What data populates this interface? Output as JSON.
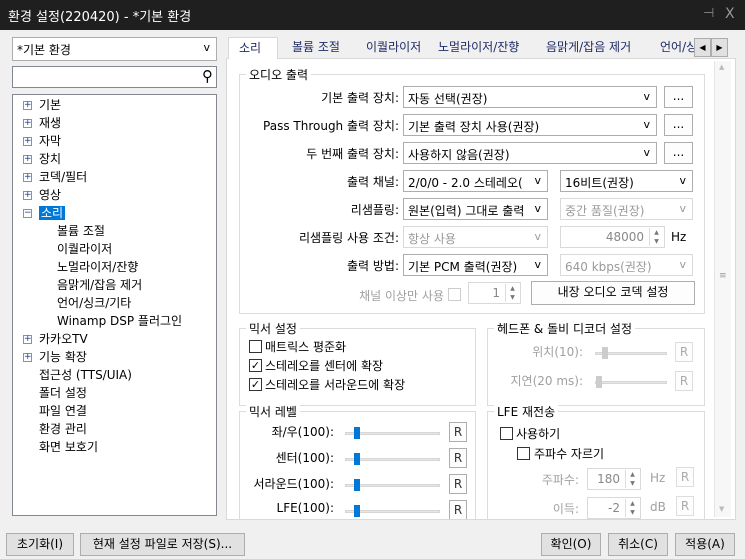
{
  "window": {
    "title": "환경 설정(220420) - *기본 환경",
    "pin_icon": "pin-icon",
    "close_icon": "close-icon",
    "close_glyph": "X"
  },
  "profile_combo": {
    "value": "*기본 환경"
  },
  "search": {
    "value": "",
    "placeholder": ""
  },
  "tree": {
    "items": [
      {
        "label": "기본",
        "level": 0,
        "expander": "+"
      },
      {
        "label": "재생",
        "level": 0,
        "expander": "+"
      },
      {
        "label": "자막",
        "level": 0,
        "expander": "+"
      },
      {
        "label": "장치",
        "level": 0,
        "expander": "+"
      },
      {
        "label": "코덱/필터",
        "level": 0,
        "expander": "+"
      },
      {
        "label": "영상",
        "level": 0,
        "expander": "+"
      },
      {
        "label": "소리",
        "level": 0,
        "expander": "−",
        "selected": true
      },
      {
        "label": "볼륨 조절",
        "level": 1
      },
      {
        "label": "이퀄라이저",
        "level": 1
      },
      {
        "label": "노멀라이저/잔향",
        "level": 1
      },
      {
        "label": "음맑게/잡음 제거",
        "level": 1
      },
      {
        "label": "언어/싱크/기타",
        "level": 1
      },
      {
        "label": "Winamp DSP 플러그인",
        "level": 1
      },
      {
        "label": "카카오TV",
        "level": 0,
        "expander": "+"
      },
      {
        "label": "기능 확장",
        "level": 0,
        "expander": "+"
      },
      {
        "label": "접근성 (TTS/UIA)",
        "level": 0
      },
      {
        "label": "폴더 설정",
        "level": 0
      },
      {
        "label": "파일 연결",
        "level": 0
      },
      {
        "label": "환경 관리",
        "level": 0
      },
      {
        "label": "화면 보호기",
        "level": 0
      }
    ]
  },
  "tabs": [
    {
      "label": "소리",
      "active": true
    },
    {
      "label": "볼륨 조절"
    },
    {
      "label": "이퀄라이저"
    },
    {
      "label": "노멀라이저/잔향"
    },
    {
      "label": "음맑게/잡음 제거"
    },
    {
      "label": "언어/싱크"
    }
  ],
  "audio_output": {
    "title": "오디오 출력",
    "main_device": {
      "label": "기본 출력 장치:",
      "value": "자동 선택(권장)"
    },
    "passthrough": {
      "label": "Pass Through 출력 장치:",
      "value": "기본 출력 장치 사용(권장)"
    },
    "second_device": {
      "label": "두 번째 출력 장치:",
      "value": "사용하지 않음(권장)"
    },
    "more_label": "...",
    "channel": {
      "label": "출력 채널:",
      "value": "2/0/0 - 2.0 스테레오(",
      "bits": "16비트(권장)"
    },
    "resampling": {
      "label": "리샘플링:",
      "value": "원본(입력) 그대로 출력",
      "quality": "중간 품질(권장)"
    },
    "resample_cond": {
      "label": "리샘플링 사용 조건:",
      "value": "항상 사용",
      "rate": "48000",
      "unit": "Hz"
    },
    "method": {
      "label": "출력 방법:",
      "value": "기본 PCM 출력(권장)",
      "bitrate": "640 kbps(권장)"
    },
    "channel_min": {
      "label": "채널 이상만 사용",
      "value": "1"
    },
    "codec_button": "내장 오디오 코덱 설정"
  },
  "mixer_settings": {
    "title": "믹서 설정",
    "options": [
      {
        "label": "매트릭스 평준화",
        "checked": false
      },
      {
        "label": "스테레오를 센터에 확장",
        "checked": true
      },
      {
        "label": "스테레오를 서라운드에 확장",
        "checked": true
      }
    ]
  },
  "headphone": {
    "title": "헤드폰 & 돌비 디코더 설정",
    "rows": [
      {
        "label": "위치(10):",
        "value": 10
      },
      {
        "label": "지연(20 ms):",
        "value": 20
      }
    ]
  },
  "mixer_level": {
    "title": "믹서 레벨",
    "rows": [
      {
        "label": "좌/우(100):",
        "value": 100
      },
      {
        "label": "센터(100):",
        "value": 100
      },
      {
        "label": "서라운드(100):",
        "value": 100
      },
      {
        "label": "LFE(100):",
        "value": 100
      }
    ]
  },
  "lfe": {
    "title": "LFE 재전송",
    "enable": "사용하기",
    "cutoff": "주파수 자르기",
    "freq_label": "주파수:",
    "freq": "180",
    "freq_unit": "Hz",
    "gain_label": "이득:",
    "gain": "-2",
    "gain_unit": "dB"
  },
  "reset_label": "R",
  "footer": {
    "reset": "초기화(I)",
    "save": "현재 설정 파일로 저장(S)...",
    "ok": "확인(O)",
    "cancel": "취소(C)",
    "apply": "적용(A)"
  }
}
